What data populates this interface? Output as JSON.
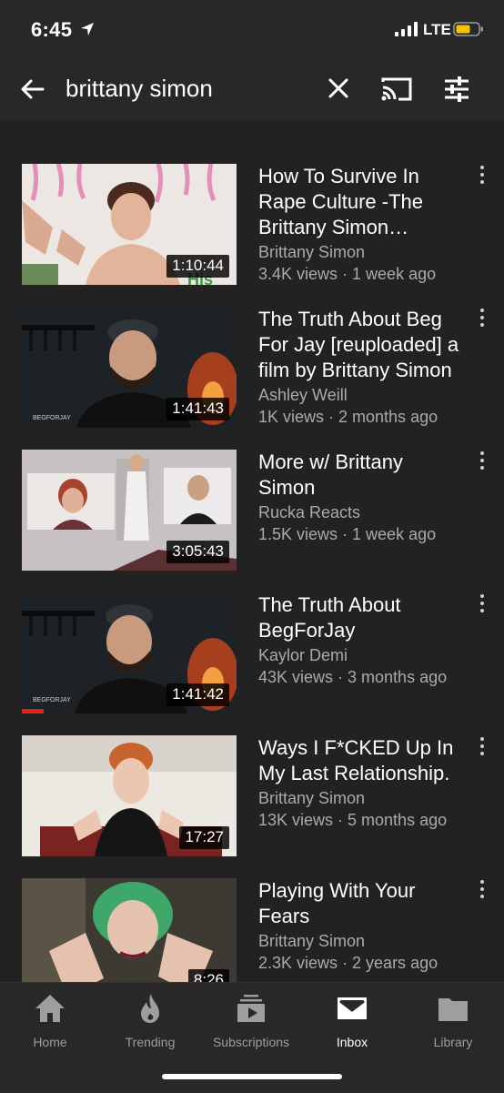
{
  "status": {
    "time": "6:45",
    "network": "LTE"
  },
  "search": {
    "query": "brittany simon"
  },
  "results": [
    {
      "title": "How To Survive In Rape Culture -The Brittany Simon Method",
      "channel": "Brittany Simon",
      "stats": "3.4K views · 1 week ago",
      "duration": "1:10:44"
    },
    {
      "title": "The Truth About Beg For Jay [reuploaded] a film by Brittany Simon",
      "channel": "Ashley Weill",
      "stats": "1K views · 2 months ago",
      "duration": "1:41:43"
    },
    {
      "title": "More w/ Brittany Simon",
      "channel": "Rucka Reacts",
      "stats": "1.5K views · 1 week ago",
      "duration": "3:05:43"
    },
    {
      "title": "The Truth About BegForJay",
      "channel": "Kaylor Demi",
      "stats": "43K views · 3 months ago",
      "duration": "1:41:42",
      "watched_fraction": 0.1
    },
    {
      "title": "Ways I F*CKED Up In My Last Relationship.",
      "channel": "Brittany Simon",
      "stats": "13K views · 5 months ago",
      "duration": "17:27"
    },
    {
      "title": "Playing With Your Fears",
      "channel": "Brittany Simon",
      "stats": "2.3K views · 2 years ago",
      "duration": "8:26"
    }
  ],
  "nav": {
    "home": "Home",
    "trending": "Trending",
    "subscriptions": "Subscriptions",
    "inbox": "Inbox",
    "library": "Library",
    "active": "Inbox"
  },
  "colors": {
    "background": "#222222",
    "bar": "#282828",
    "secondary_text": "#aaaaaa",
    "progress": "#e62117",
    "battery": "#f5c400"
  }
}
